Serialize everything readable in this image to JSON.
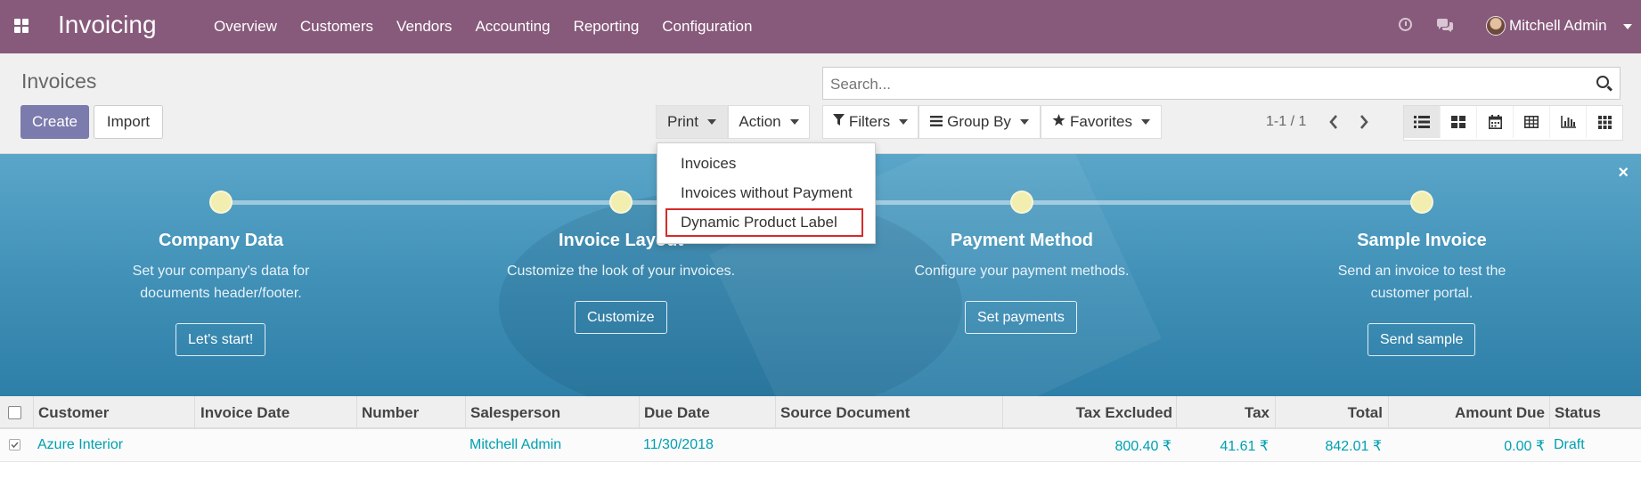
{
  "navbar": {
    "app_title": "Invoicing",
    "menu": [
      "Overview",
      "Customers",
      "Vendors",
      "Accounting",
      "Reporting",
      "Configuration"
    ],
    "user_name": "Mitchell Admin"
  },
  "control_panel": {
    "title": "Invoices",
    "create_label": "Create",
    "import_label": "Import",
    "print_label": "Print",
    "action_label": "Action",
    "search_placeholder": "Search...",
    "filters_label": "Filters",
    "groupby_label": "Group By",
    "favorites_label": "Favorites",
    "pager": "1-1 / 1"
  },
  "print_menu": [
    "Invoices",
    "Invoices without Payment",
    "Dynamic Product Label"
  ],
  "onboarding": {
    "steps": [
      {
        "title": "Company Data",
        "desc": [
          "Set your company's data for",
          "documents header/footer."
        ],
        "button": "Let's start!"
      },
      {
        "title": "Invoice Layout",
        "desc": [
          "Customize the look of your invoices."
        ],
        "button": "Customize"
      },
      {
        "title": "Payment Method",
        "desc": [
          "Configure your payment methods."
        ],
        "button": "Set payments"
      },
      {
        "title": "Sample Invoice",
        "desc": [
          "Send an invoice to test the",
          "customer portal."
        ],
        "button": "Send sample"
      }
    ],
    "close": "×"
  },
  "table": {
    "columns": [
      "Customer",
      "Invoice Date",
      "Number",
      "Salesperson",
      "Due Date",
      "Source Document",
      "Tax Excluded",
      "Tax",
      "Total",
      "Amount Due",
      "Status"
    ],
    "rows": [
      {
        "customer": "Azure Interior",
        "invoice_date": "",
        "number": "",
        "salesperson": "Mitchell Admin",
        "due_date": "11/30/2018",
        "source": "",
        "tax_excluded": "800.40 ₹",
        "tax": "41.61 ₹",
        "total": "842.01 ₹",
        "amount_due": "0.00 ₹",
        "status": "Draft"
      }
    ]
  }
}
